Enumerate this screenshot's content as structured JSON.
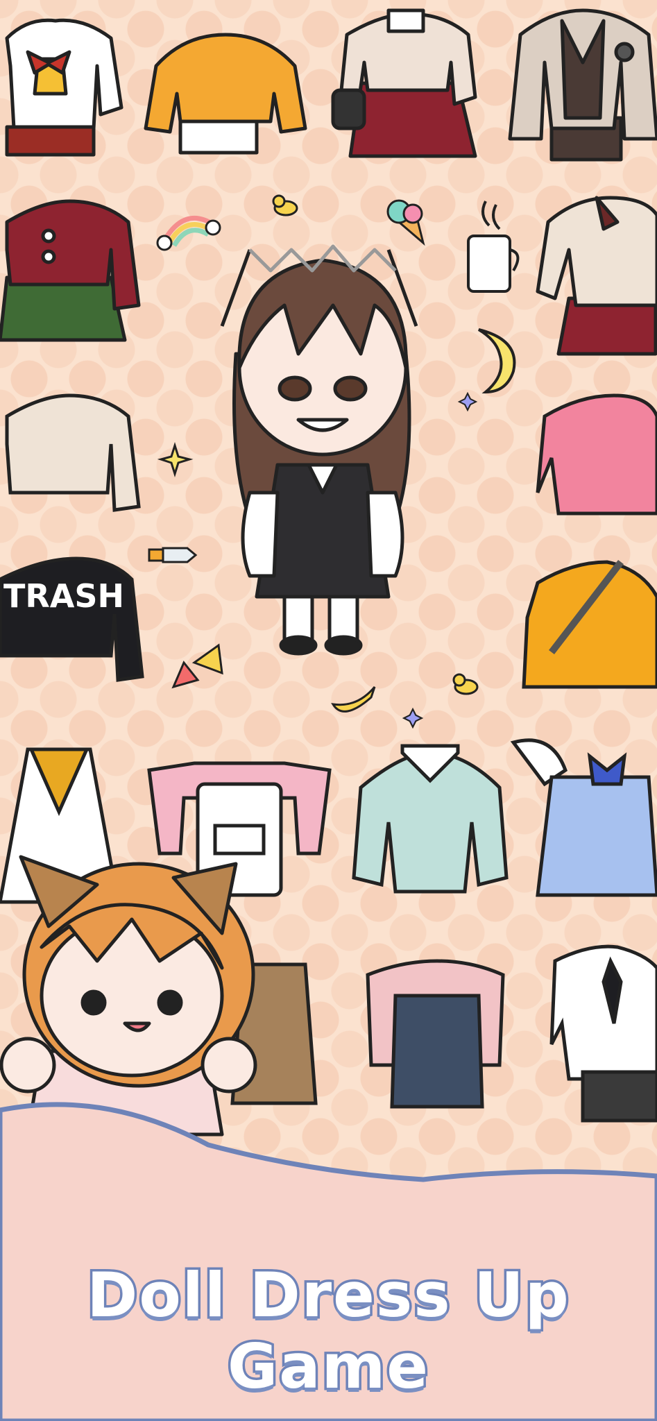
{
  "title": "Doll Dress Up Game",
  "icons": [
    "rainbow-icon",
    "duck-icon",
    "ice-cream-icon",
    "coffee-mug-icon",
    "moon-icon",
    "sparkle-icon",
    "banana-icon",
    "sword-icon",
    "triangle-icon"
  ],
  "colors": {
    "background": "#fbe2cf",
    "dots": "#f7d2bb",
    "banner": "#f6cfc6",
    "banner_edge": "#6e83b8",
    "title_stroke": "#6e83b8"
  }
}
